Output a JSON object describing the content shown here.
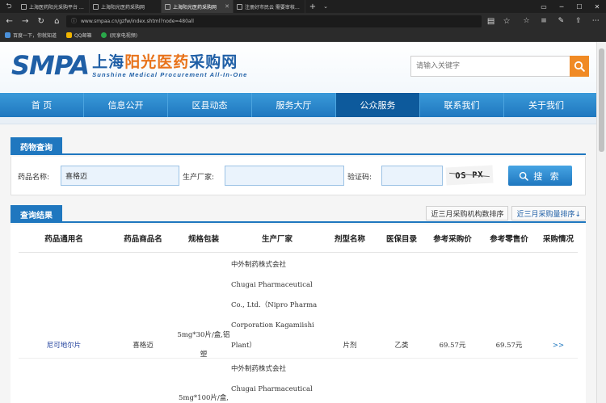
{
  "browser": {
    "tabs": [
      {
        "title": "上海医药阳光采购平台 介绍",
        "active": false
      },
      {
        "title": "上海阳光医药采购网",
        "active": false
      },
      {
        "title": "上海阳光医药采购网",
        "active": true
      },
      {
        "title": "注册好市民云 需要审核_百度",
        "active": false
      }
    ],
    "url": "www.smpaa.cn/gzfw/index.shtml?node=480all",
    "favorites": [
      {
        "label": "百度一下，你就知道"
      },
      {
        "label": "QQ邮箱"
      },
      {
        "label": "(民享电视频)"
      }
    ]
  },
  "site": {
    "logo_mark": "SMPA",
    "logo_cn_1": "上海",
    "logo_cn_2": "阳光医药",
    "logo_cn_3": "采购网",
    "logo_en": "Sunshine Medical Procurement All-In-One",
    "search_placeholder": "请输入关键字",
    "nav": [
      {
        "label": "首 页",
        "active": false
      },
      {
        "label": "信息公开",
        "active": false
      },
      {
        "label": "区县动态",
        "active": false
      },
      {
        "label": "服务大厅",
        "active": false
      },
      {
        "label": "公众服务",
        "active": true
      },
      {
        "label": "联系我们",
        "active": false
      },
      {
        "label": "关于我们",
        "active": false
      }
    ]
  },
  "query": {
    "section_title": "药物查询",
    "drug_name_label": "药品名称:",
    "drug_name_value": "喜格迈",
    "manufacturer_label": "生产厂家:",
    "manufacturer_value": "",
    "code_label": "验证码:",
    "code_value": "",
    "captcha_text": "OS PX",
    "search_button": "搜 索"
  },
  "results": {
    "section_title": "查询结果",
    "sort_by_institutions": "近三月采购机构数排序",
    "sort_by_volume": "近三月采购量排序↓",
    "columns": [
      "药品通用名",
      "药品商品名",
      "规格包装",
      "生产厂家",
      "剂型名称",
      "医保目录",
      "参考采购价",
      "参考零售价",
      "采购情况"
    ],
    "rows": [
      {
        "generic_name": "尼可地尔片",
        "trade_name": "喜格迈",
        "pack_1": "5mg*30片/盒,铝",
        "pack_2": "塑",
        "mfr_lines": [
          "中外制药株式会社",
          "Chugai Pharmaceutical",
          "Co., Ltd.（Nipro Pharma",
          "Corporation Kagamiishi",
          "Plant）"
        ],
        "dosage_form": "片剂",
        "insurance": "乙类",
        "purchase_price": "69.57元",
        "retail_price": "69.57元",
        "purchase_status": ">>"
      },
      {
        "pack_1": "5mg*100片/盒,",
        "mfr_lines": [
          "中外制药株式会社",
          "Chugai Pharmaceutical"
        ]
      }
    ]
  },
  "colors": {
    "brand_blue": "#1f77bf",
    "nav_active": "#0d5a9c",
    "accent_orange": "#f08a24"
  }
}
